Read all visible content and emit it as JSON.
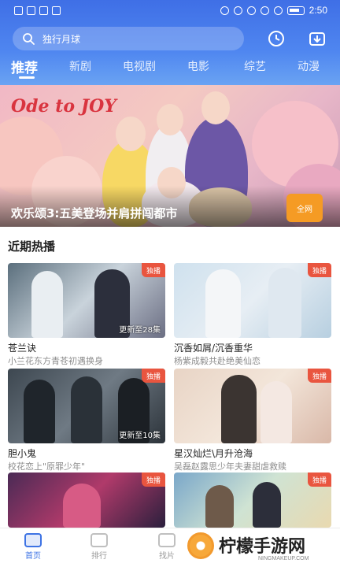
{
  "status_bar": {
    "time": "2:50"
  },
  "search": {
    "placeholder": "独行月球"
  },
  "header_icons": [
    "history-icon",
    "download-icon"
  ],
  "tabs": [
    {
      "label": "推荐",
      "active": true
    },
    {
      "label": "新剧",
      "active": false
    },
    {
      "label": "电视剧",
      "active": false
    },
    {
      "label": "电影",
      "active": false
    },
    {
      "label": "综艺",
      "active": false
    },
    {
      "label": "动漫",
      "active": false
    }
  ],
  "banner": {
    "logo_text": "Ode to JOY",
    "title": "欢乐颂3:五美登场并肩拼闯都市",
    "badge": "全网"
  },
  "section": {
    "title": "近期热播"
  },
  "cards": [
    {
      "title": "苍兰诀",
      "subtitle": "小兰花东方青苍初遇换身",
      "badge": "独播",
      "episode": "更新至28集"
    },
    {
      "title": "沉香如屑/沉香重华",
      "subtitle": "杨紫成毅共赴绝美仙恋",
      "badge": "独播",
      "episode": ""
    },
    {
      "title": "胆小鬼",
      "subtitle": "校花恋上\"原罪少年\"",
      "badge": "独播",
      "episode": "更新至10集"
    },
    {
      "title": "星汉灿烂\\月升沧海",
      "subtitle": "吴磊赵露思少年夫妻甜虐救赎",
      "badge": "独播",
      "episode": ""
    },
    {
      "title": "",
      "subtitle": "",
      "badge": "独播",
      "episode": ""
    },
    {
      "title": "",
      "subtitle": "",
      "badge": "独播",
      "episode": ""
    }
  ],
  "bottom_nav": [
    {
      "label": "首页",
      "active": true
    },
    {
      "label": "排行",
      "active": false
    },
    {
      "label": "找片",
      "active": false
    }
  ],
  "watermark": {
    "text": "柠檬手游网",
    "sub": "NINGMAKEUP.COM"
  },
  "colors": {
    "accent": "#3d73e4",
    "badge": "#e9553f"
  }
}
